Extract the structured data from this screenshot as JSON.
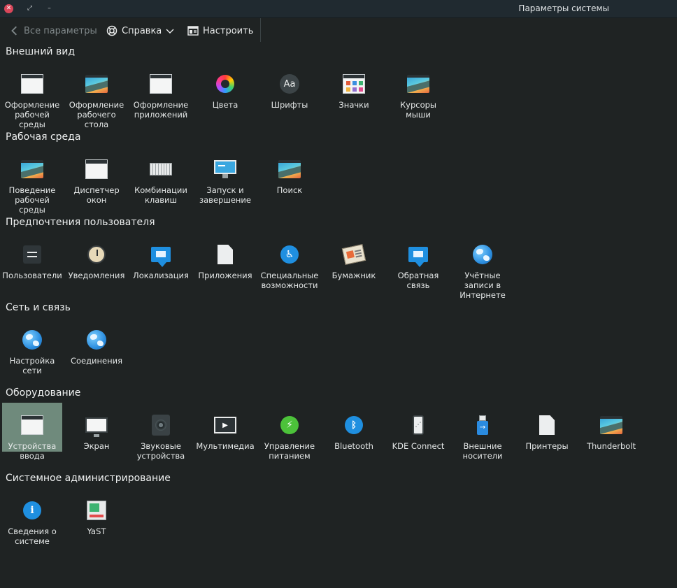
{
  "window": {
    "title": "Параметры системы"
  },
  "toolbar": {
    "back_label": "Все параметры",
    "help_label": "Справка",
    "configure_label": "Настроить"
  },
  "sections": [
    {
      "title": "Внешний вид",
      "items": [
        {
          "label": "Оформление рабочей среды",
          "icon": "window-icon"
        },
        {
          "label": "Оформление рабочего стола",
          "icon": "landscape-icon"
        },
        {
          "label": "Оформление приложений",
          "icon": "window-icon"
        },
        {
          "label": "Цвета",
          "icon": "colors-icon"
        },
        {
          "label": "Шрифты",
          "icon": "fonts-icon"
        },
        {
          "label": "Значки",
          "icon": "icons-icon"
        },
        {
          "label": "Курсоры мыши",
          "icon": "landscape-icon"
        }
      ]
    },
    {
      "title": "Рабочая среда",
      "items": [
        {
          "label": "Поведение рабочей среды",
          "icon": "landscape-icon"
        },
        {
          "label": "Диспетчер окон",
          "icon": "window-icon"
        },
        {
          "label": "Комбинации клавиш",
          "icon": "keyboard-icon"
        },
        {
          "label": "Запуск и завершение",
          "icon": "monitor-icon"
        },
        {
          "label": "Поиск",
          "icon": "landscape-icon"
        }
      ]
    },
    {
      "title": "Предпочтения пользователя",
      "items": [
        {
          "label": "Пользователи",
          "icon": "users-icon"
        },
        {
          "label": "Уведомления",
          "icon": "clock-icon"
        },
        {
          "label": "Локализация",
          "icon": "chat-icon"
        },
        {
          "label": "Приложения",
          "icon": "document-icon"
        },
        {
          "label": "Специальные возможности",
          "icon": "accessibility-icon"
        },
        {
          "label": "Бумажник",
          "icon": "wallet-icon"
        },
        {
          "label": "Обратная связь",
          "icon": "chat-icon"
        },
        {
          "label": "Учётные записи в Интернете",
          "icon": "globe-icon"
        }
      ]
    },
    {
      "title": "Сеть и связь",
      "items": [
        {
          "label": "Настройка сети",
          "icon": "globe-icon"
        },
        {
          "label": "Соединения",
          "icon": "globe-icon"
        }
      ]
    },
    {
      "title": "Оборудование",
      "items": [
        {
          "label": "Устройства ввода",
          "icon": "window-icon",
          "selected": true
        },
        {
          "label": "Экран",
          "icon": "display-icon"
        },
        {
          "label": "Звуковые устройства",
          "icon": "speaker-icon"
        },
        {
          "label": "Мультимедиа",
          "icon": "multimedia-icon"
        },
        {
          "label": "Управление питанием",
          "icon": "power-icon"
        },
        {
          "label": "Bluetooth",
          "icon": "bluetooth-icon"
        },
        {
          "label": "KDE Connect",
          "icon": "phone-icon"
        },
        {
          "label": "Внешние носители",
          "icon": "usb-icon"
        },
        {
          "label": "Принтеры",
          "icon": "document-icon"
        },
        {
          "label": "Thunderbolt",
          "icon": "landscape-icon"
        }
      ]
    },
    {
      "title": "Системное администрирование",
      "items": [
        {
          "label": "Сведения о системе",
          "icon": "info-icon"
        },
        {
          "label": "YaST",
          "icon": "yast-icon"
        }
      ]
    }
  ],
  "colors": {
    "background": "#1f2323",
    "selected": "#6f8a7c",
    "accent": "#1f8fe0"
  }
}
